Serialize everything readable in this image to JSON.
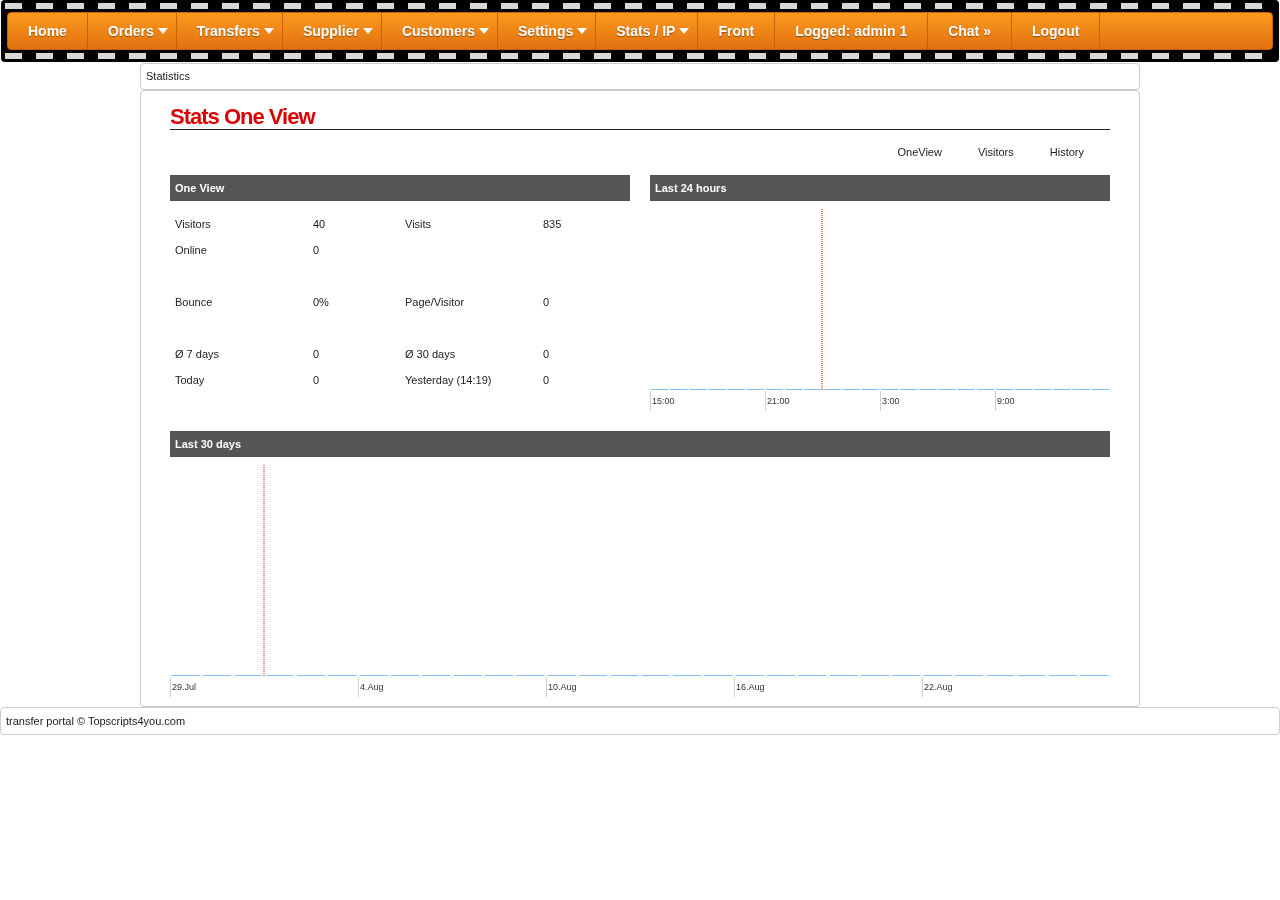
{
  "nav": [
    {
      "label": "Home",
      "dropdown": false
    },
    {
      "label": "Orders",
      "dropdown": true
    },
    {
      "label": "Transfers",
      "dropdown": true
    },
    {
      "label": "Supplier",
      "dropdown": true
    },
    {
      "label": "Customers",
      "dropdown": true
    },
    {
      "label": "Settings",
      "dropdown": true
    },
    {
      "label": "Stats / IP",
      "dropdown": true
    },
    {
      "label": "Front",
      "dropdown": false
    },
    {
      "label": "Logged: admin 1",
      "dropdown": false
    },
    {
      "label": "Chat »",
      "dropdown": false
    },
    {
      "label": "Logout",
      "dropdown": false
    }
  ],
  "breadcrumb": "Statistics",
  "title": "Stats One View",
  "subtabs": [
    "OneView",
    "Visitors",
    "History"
  ],
  "one_view": {
    "heading": "One View",
    "rows": [
      [
        "Visitors",
        "40",
        "Visits",
        "835"
      ],
      [
        "Online",
        "0",
        "",
        ""
      ],
      [
        "",
        "",
        "",
        ""
      ],
      [
        "Bounce",
        "0%",
        "Page/Visitor",
        "0"
      ],
      [
        "",
        "",
        "",
        ""
      ],
      [
        "Ø 7 days",
        "0",
        "Ø 30 days",
        "0"
      ],
      [
        "Today",
        "0",
        "Yesterday (14:19)",
        "0"
      ]
    ]
  },
  "last_24": {
    "heading": "Last 24 hours",
    "x_labels": [
      "15:00",
      "21:00",
      "3:00",
      "9:00"
    ]
  },
  "last_30": {
    "heading": "Last 30 days",
    "x_labels": [
      "29.Jul",
      "4.Aug",
      "10.Aug",
      "16.Aug",
      "22.Aug"
    ]
  },
  "footer": "transfer portal © Topscripts4you.com"
}
